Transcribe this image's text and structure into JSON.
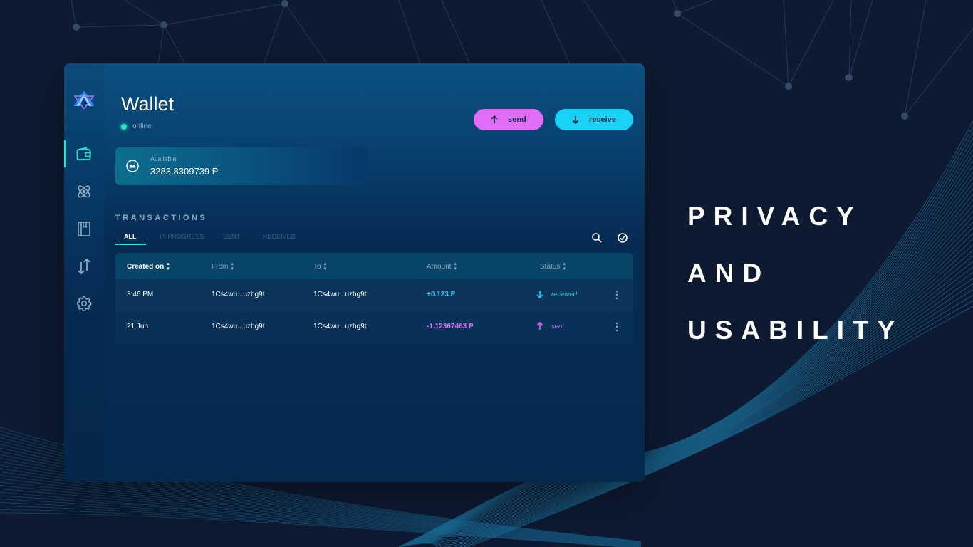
{
  "app": {
    "title": "Wallet",
    "status": "online",
    "send_label": "send",
    "receive_label": "receive",
    "balance": {
      "label": "Available",
      "value": "3283.8309739 Ᵽ"
    },
    "nav": [
      "wallet-icon",
      "atom-icon",
      "book-icon",
      "transfer-icon",
      "gear-icon"
    ],
    "transactions": {
      "title": "TRANSACTIONS",
      "tabs": [
        "ALL",
        "IN PROGRESS",
        "SENT",
        "RECEIVED"
      ],
      "columns": [
        "Created on",
        "From",
        "To",
        "Amount",
        "Status"
      ],
      "rows": [
        {
          "created": "3:46 PM",
          "from": "1Cs4wu...uzbg9t",
          "to": "1Cs4wu...uzbg9t",
          "amount": "+0.123 Ᵽ",
          "status": "received"
        },
        {
          "created": "21 Jun",
          "from": "1Cs4wu...uzbg9t",
          "to": "1Cs4wu...uzbg9t",
          "amount": "-1.12367463 Ᵽ",
          "status": "sent"
        }
      ]
    }
  },
  "hero": {
    "line1": "PRIVACY",
    "line2": "AND",
    "line3": "USABILITY"
  },
  "colors": {
    "accent": "#27e7d4",
    "send": "#df6df5",
    "receive": "#19d2f6",
    "background": "#0d1a31"
  }
}
